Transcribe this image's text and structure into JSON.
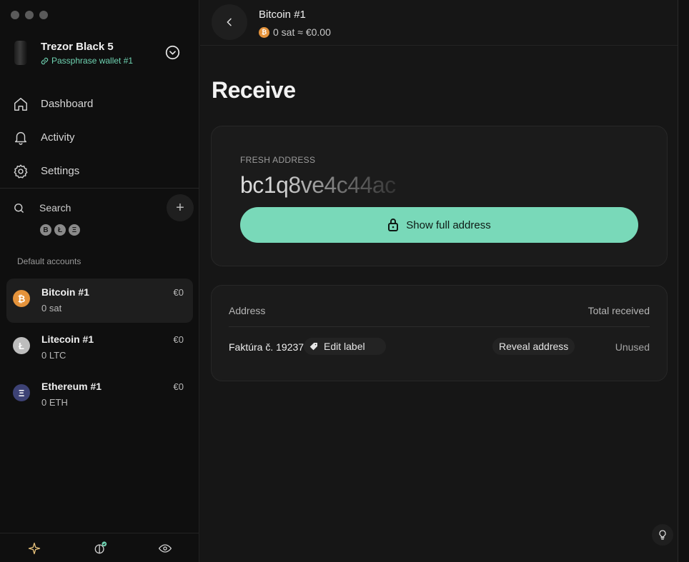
{
  "device": {
    "name": "Trezor Black 5",
    "wallet": "Passphrase wallet #1"
  },
  "nav": {
    "items": [
      {
        "label": "Dashboard",
        "icon": "home-icon"
      },
      {
        "label": "Activity",
        "icon": "bell-icon"
      },
      {
        "label": "Settings",
        "icon": "gear-icon"
      }
    ]
  },
  "search": {
    "label": "Search",
    "add_symbol": "+"
  },
  "coin_filters": [
    "B",
    "Ł",
    "Ξ"
  ],
  "accounts": {
    "section_label": "Default accounts",
    "items": [
      {
        "name": "Bitcoin #1",
        "balance": "0 sat",
        "fiat": "€0",
        "symbol": "₿",
        "color": "#e5933b"
      },
      {
        "name": "Litecoin #1",
        "balance": "0 LTC",
        "fiat": "€0",
        "symbol": "Ł",
        "color": "#bdbdbd"
      },
      {
        "name": "Ethereum #1",
        "balance": "0 ETH",
        "fiat": "€0",
        "symbol": "Ξ",
        "color": "#3d4275"
      }
    ]
  },
  "header": {
    "title": "Bitcoin #1",
    "subtitle": "0 sat ≈ €0.00",
    "coin_symbol": "₿"
  },
  "page": {
    "title": "Receive"
  },
  "fresh_address": {
    "label": "FRESH ADDRESS",
    "partial_address": "bc1q8ve4c44ac",
    "button_label": "Show full address"
  },
  "address_table": {
    "col_address": "Address",
    "col_total": "Total received",
    "rows": [
      {
        "label": "Faktúra č. 19237",
        "edit_label": "Edit label",
        "reveal_label": "Reveal address",
        "status": "Unused"
      }
    ]
  },
  "colors": {
    "accent": "#79d9b9",
    "bitcoin": "#e5933b",
    "link_green": "#6fd3b2"
  }
}
